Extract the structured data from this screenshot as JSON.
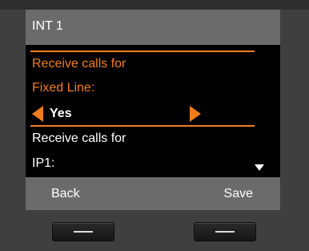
{
  "header": {
    "title": "INT 1"
  },
  "setting_fixed_line": {
    "label_line1": "Receive calls for",
    "label_line2": "Fixed Line:",
    "value": "Yes"
  },
  "setting_ip1": {
    "label_line1": "Receive calls for",
    "label_line2": "IP1:"
  },
  "softkeys": {
    "left_label": "Back",
    "right_label": "Save"
  },
  "colors": {
    "accent": "#f07e1e",
    "screen_bg": "#000000",
    "bar_bg": "#6b6b6b"
  }
}
